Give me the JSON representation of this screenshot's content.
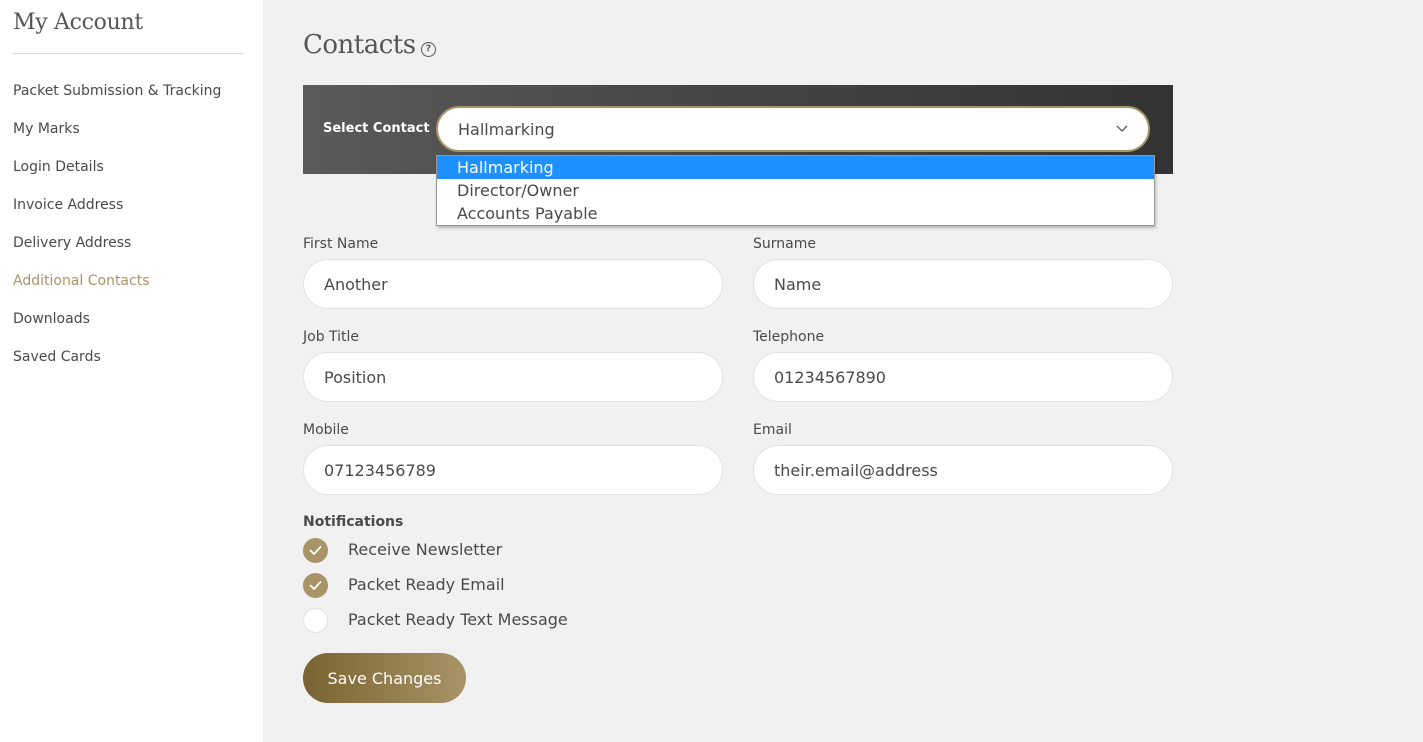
{
  "sidebar": {
    "title": "My Account",
    "items": [
      {
        "label": "Packet Submission & Tracking"
      },
      {
        "label": "My Marks"
      },
      {
        "label": "Login Details"
      },
      {
        "label": "Invoice Address"
      },
      {
        "label": "Delivery Address"
      },
      {
        "label": "Additional Contacts",
        "active": true
      },
      {
        "label": "Downloads"
      },
      {
        "label": "Saved Cards"
      }
    ]
  },
  "main": {
    "title": "Contacts",
    "help_icon": "question-circle-icon",
    "select_contact": {
      "label": "Select Contact",
      "value": "Hallmarking",
      "options": [
        "Hallmarking",
        "Director/Owner",
        "Accounts Payable"
      ]
    },
    "form": {
      "first_name": {
        "label": "First Name",
        "value": "Another"
      },
      "surname": {
        "label": "Surname",
        "value": "Name"
      },
      "job_title": {
        "label": "Job Title",
        "value": "Position"
      },
      "telephone": {
        "label": "Telephone",
        "value": "01234567890"
      },
      "mobile": {
        "label": "Mobile",
        "value": "07123456789"
      },
      "email": {
        "label": "Email",
        "value": "their.email@address"
      }
    },
    "notifications": {
      "title": "Notifications",
      "items": [
        {
          "label": "Receive Newsletter",
          "checked": true
        },
        {
          "label": "Packet Ready Email",
          "checked": true
        },
        {
          "label": "Packet Ready Text Message",
          "checked": false
        }
      ]
    },
    "save_label": "Save Changes"
  },
  "colors": {
    "accent": "#a89467",
    "dropdown_highlight": "#1e90ff",
    "select_bar": "#444444"
  }
}
